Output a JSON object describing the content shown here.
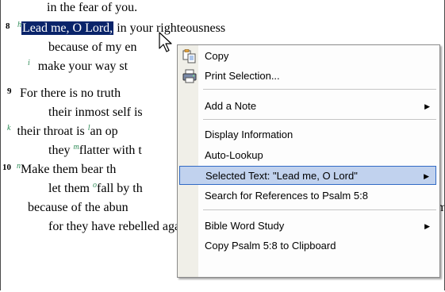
{
  "text": {
    "l1": "in the fear of you.",
    "v8_num": "8",
    "v8_fn": "h",
    "v8_sel": "Lead me, O Lord,",
    "v8_rest": " in your righteousness",
    "l3": "because of my en",
    "l4_fn": "i",
    "l4": "make your way st",
    "v9_num": "9",
    "l5": "For there is no truth",
    "l6": "their inmost self is",
    "l7_fn": "k",
    "l7a": "their throat is ",
    "l7_fn2": "l",
    "l7b": "an op",
    "l8a": "they ",
    "l8_fn": "m",
    "l8b": "flatter with t",
    "v10_num": "10",
    "v10_fn": "n",
    "l9": "Make them bear th",
    "l10a": "let them ",
    "l10_fn": "o",
    "l10b": "fall by th",
    "l11": "because of the abun",
    "l11_tail": "m",
    "l12": "for they have rebelled against you."
  },
  "menu": {
    "copy": "Copy",
    "print": "Print Selection...",
    "add_note": "Add a Note",
    "display_info": "Display Information",
    "auto_lookup": "Auto-Lookup",
    "selected_text": "Selected Text: \"Lead me, O Lord\"",
    "search_refs": "Search for References to Psalm 5:8",
    "bible_word_study": "Bible Word Study",
    "copy_clipboard": "Copy Psalm 5:8 to Clipboard",
    "submenu_arrow": "▶",
    "icons": {
      "copy": "copy-icon",
      "print": "printer-icon"
    },
    "highlight_color": "#c1d2ee",
    "highlight_border": "#316ac5"
  },
  "colors": {
    "selection_bg": "#0a246a",
    "footnote": "#2e8b57"
  }
}
